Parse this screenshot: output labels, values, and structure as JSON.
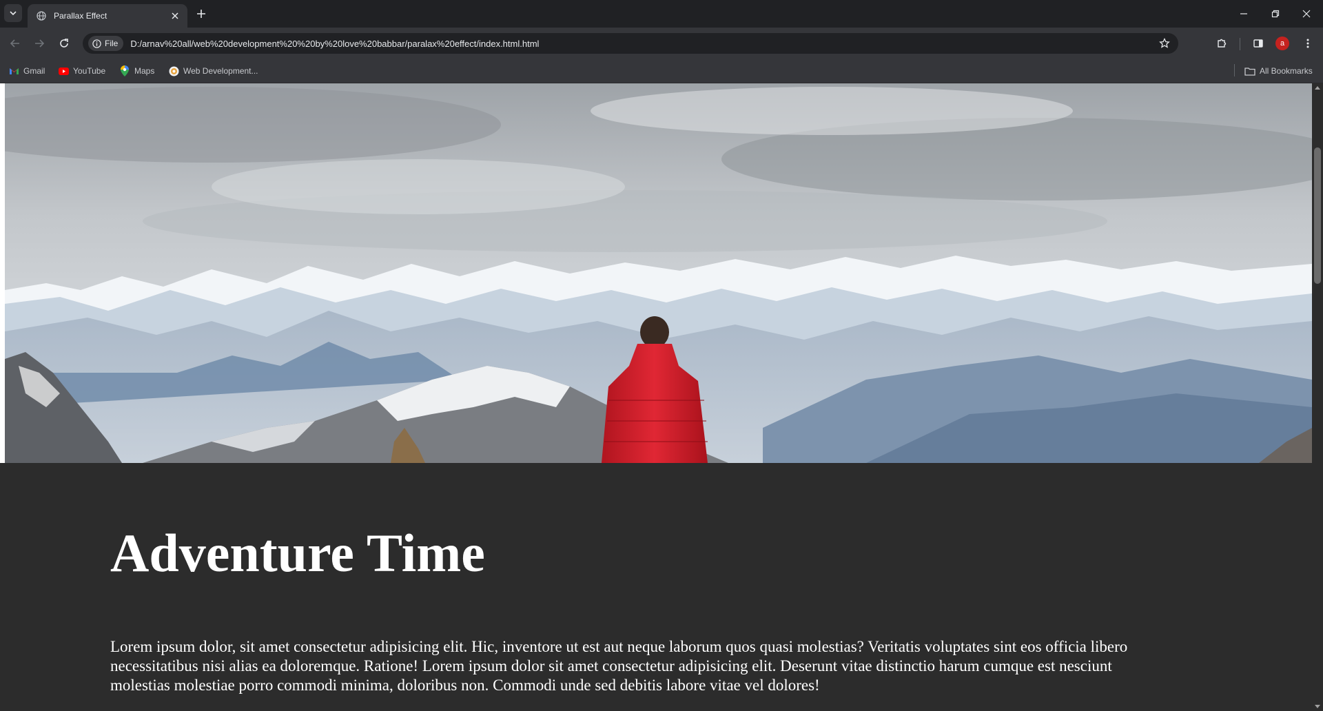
{
  "browser": {
    "tab": {
      "title": "Parallax Effect"
    },
    "omnibox": {
      "chip_label": "File",
      "url": "D:/arnav%20all/web%20development%20%20by%20love%20babbar/paralax%20effect/index.html.html"
    },
    "profile_initial": "a",
    "bookmarks": [
      {
        "label": "Gmail",
        "icon": "gmail-icon"
      },
      {
        "label": "YouTube",
        "icon": "youtube-icon"
      },
      {
        "label": "Maps",
        "icon": "maps-icon"
      },
      {
        "label": "Web Development...",
        "icon": "web-development-icon"
      }
    ],
    "all_bookmarks_label": "All Bookmarks"
  },
  "page": {
    "heading": "Adventure Time",
    "paragraph": "Lorem ipsum dolor, sit amet consectetur adipisicing elit. Hic, inventore ut est aut neque laborum quos quasi molestias? Veritatis voluptates sint eos officia libero necessitatibus nisi alias ea doloremque. Ratione! Lorem ipsum dolor sit amet consectetur adipisicing elit. Deserunt vitae distinctio harum cumque est nesciunt molestias molestiae porro commodi minima, doloribus non. Commodi unde sed debitis labore vitae vel dolores!"
  },
  "colors": {
    "page_background": "#2c2c2c",
    "chrome_dark": "#202124",
    "chrome_toolbar": "#35363a",
    "jacket_red": "#d0202e"
  }
}
